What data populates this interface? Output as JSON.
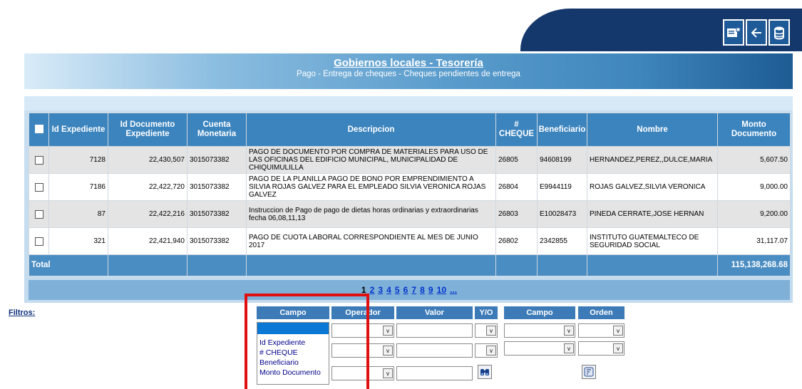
{
  "toolbar": {
    "icons": [
      "card-icon",
      "back-arrow-icon",
      "database-icon"
    ]
  },
  "header": {
    "title": "Gobiernos locales - Tesorería",
    "subtitle": "Pago - Entrega de cheques - Cheques pendientes de entrega"
  },
  "table": {
    "columns": [
      "Id Expediente",
      "Id Documento Expediente",
      "Cuenta Monetaria",
      "Descripcion",
      "# CHEQUE",
      "Beneficiario",
      "Nombre",
      "Monto Documento"
    ],
    "rows": [
      {
        "id_expediente": "7128",
        "id_documento": "22,430,507",
        "cuenta": "3015073382",
        "descripcion": "PAGO DE DOCUMENTO POR COMPRA DE MATERIALES PARA USO DE LAS OFICINAS DEL EDIFICIO MUNICIPAL, MUNICIPALIDAD DE CHIQUIMULILLA",
        "cheque": "26805",
        "beneficiario": "94608199",
        "nombre": "HERNANDEZ,PEREZ,,DULCE,MARIA",
        "monto": "5,607.50"
      },
      {
        "id_expediente": "7186",
        "id_documento": "22,422,720",
        "cuenta": "3015073382",
        "descripcion": "PAGO DE LA PLANILLA PAGO DE BONO POR EMPRENDIMIENTO A SILVIA ROJAS GALVEZ PARA EL EMPLEADO SILVIA VERONICA ROJAS GALVEZ",
        "cheque": "26804",
        "beneficiario": "E9944119",
        "nombre": "ROJAS GALVEZ,SILVIA VERONICA",
        "monto": "9,000.00"
      },
      {
        "id_expediente": "87",
        "id_documento": "22,422,216",
        "cuenta": "3015073382",
        "descripcion": "Instruccion de Pago de pago de dietas horas ordinarias y extraordinarias fecha 06,08,11,13",
        "cheque": "26803",
        "beneficiario": "E10028473",
        "nombre": "PINEDA CERRATE,JOSE HERNAN",
        "monto": "9,200.00"
      },
      {
        "id_expediente": "321",
        "id_documento": "22,421,940",
        "cuenta": "3015073382",
        "descripcion": "PAGO DE CUOTA LABORAL CORRESPONDIENTE AL MES DE JUNIO 2017",
        "cheque": "26802",
        "beneficiario": "2342855",
        "nombre": "INSTITUTO GUATEMALTECO DE SEGURIDAD SOCIAL",
        "monto": "31,117.07"
      }
    ],
    "total_label": "Total",
    "total_value": "115,138,268.68"
  },
  "pager": {
    "current": "1",
    "pages": [
      "2",
      "3",
      "4",
      "5",
      "6",
      "7",
      "8",
      "9",
      "10",
      "..."
    ]
  },
  "filters": {
    "label": "Filtros:",
    "headers": {
      "campo": "Campo",
      "operador": "Operador",
      "valor": "Valor",
      "yo": "Y/O",
      "campo2": "Campo",
      "orden": "Orden"
    },
    "campo_options": [
      "Id Expediente",
      "# CHEQUE",
      "Beneficiario",
      "Monto Documento"
    ],
    "arrow": "v"
  },
  "colors": {
    "header_dark": "#14376c",
    "table_header": "#3c84be",
    "total_row": "#4a8dc2",
    "highlight_box": "#e01010",
    "link": "#0033cc"
  }
}
